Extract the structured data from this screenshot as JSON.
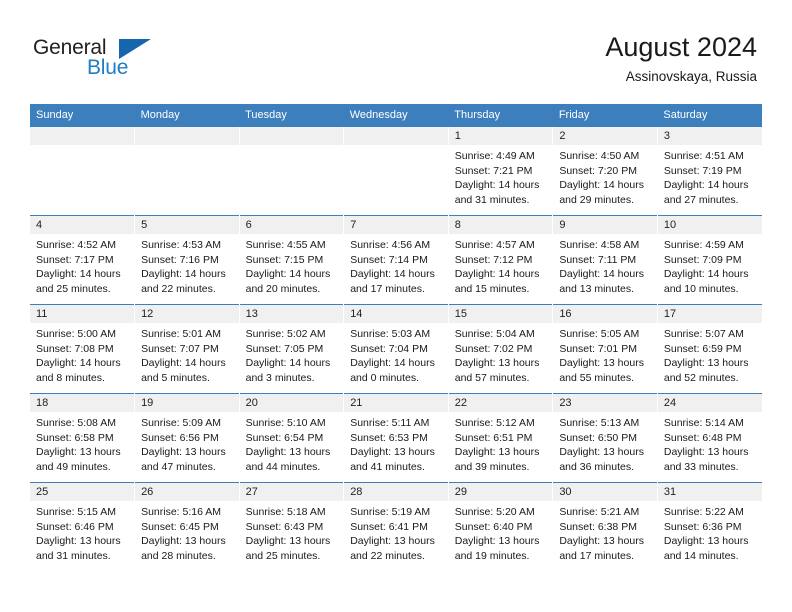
{
  "brand": {
    "name_top": "General",
    "name_bottom": "Blue",
    "triangle_color": "#1566ad",
    "blue_color": "#1f7fc4",
    "dark_color": "#231f20"
  },
  "header": {
    "title": "August 2024",
    "subtitle": "Assinovskaya, Russia"
  },
  "theme": {
    "header_bg": "#3d7ebd",
    "header_text": "#ffffff",
    "daynum_bg": "#f0f0f0",
    "cell_bg": "#ffffff",
    "row_border": "#3d7ebd"
  },
  "weekdays": [
    "Sunday",
    "Monday",
    "Tuesday",
    "Wednesday",
    "Thursday",
    "Friday",
    "Saturday"
  ],
  "labels": {
    "sunrise_prefix": "Sunrise: ",
    "sunset_prefix": "Sunset: ",
    "daylight_prefix": "Daylight: "
  },
  "weeks": [
    [
      {
        "day": "",
        "empty": true
      },
      {
        "day": "",
        "empty": true
      },
      {
        "day": "",
        "empty": true
      },
      {
        "day": "",
        "empty": true
      },
      {
        "day": "1",
        "sunrise": "Sunrise: 4:49 AM",
        "sunset": "Sunset: 7:21 PM",
        "daylight": "Daylight: 14 hours and 31 minutes."
      },
      {
        "day": "2",
        "sunrise": "Sunrise: 4:50 AM",
        "sunset": "Sunset: 7:20 PM",
        "daylight": "Daylight: 14 hours and 29 minutes."
      },
      {
        "day": "3",
        "sunrise": "Sunrise: 4:51 AM",
        "sunset": "Sunset: 7:19 PM",
        "daylight": "Daylight: 14 hours and 27 minutes."
      }
    ],
    [
      {
        "day": "4",
        "sunrise": "Sunrise: 4:52 AM",
        "sunset": "Sunset: 7:17 PM",
        "daylight": "Daylight: 14 hours and 25 minutes."
      },
      {
        "day": "5",
        "sunrise": "Sunrise: 4:53 AM",
        "sunset": "Sunset: 7:16 PM",
        "daylight": "Daylight: 14 hours and 22 minutes."
      },
      {
        "day": "6",
        "sunrise": "Sunrise: 4:55 AM",
        "sunset": "Sunset: 7:15 PM",
        "daylight": "Daylight: 14 hours and 20 minutes."
      },
      {
        "day": "7",
        "sunrise": "Sunrise: 4:56 AM",
        "sunset": "Sunset: 7:14 PM",
        "daylight": "Daylight: 14 hours and 17 minutes."
      },
      {
        "day": "8",
        "sunrise": "Sunrise: 4:57 AM",
        "sunset": "Sunset: 7:12 PM",
        "daylight": "Daylight: 14 hours and 15 minutes."
      },
      {
        "day": "9",
        "sunrise": "Sunrise: 4:58 AM",
        "sunset": "Sunset: 7:11 PM",
        "daylight": "Daylight: 14 hours and 13 minutes."
      },
      {
        "day": "10",
        "sunrise": "Sunrise: 4:59 AM",
        "sunset": "Sunset: 7:09 PM",
        "daylight": "Daylight: 14 hours and 10 minutes."
      }
    ],
    [
      {
        "day": "11",
        "sunrise": "Sunrise: 5:00 AM",
        "sunset": "Sunset: 7:08 PM",
        "daylight": "Daylight: 14 hours and 8 minutes."
      },
      {
        "day": "12",
        "sunrise": "Sunrise: 5:01 AM",
        "sunset": "Sunset: 7:07 PM",
        "daylight": "Daylight: 14 hours and 5 minutes."
      },
      {
        "day": "13",
        "sunrise": "Sunrise: 5:02 AM",
        "sunset": "Sunset: 7:05 PM",
        "daylight": "Daylight: 14 hours and 3 minutes."
      },
      {
        "day": "14",
        "sunrise": "Sunrise: 5:03 AM",
        "sunset": "Sunset: 7:04 PM",
        "daylight": "Daylight: 14 hours and 0 minutes."
      },
      {
        "day": "15",
        "sunrise": "Sunrise: 5:04 AM",
        "sunset": "Sunset: 7:02 PM",
        "daylight": "Daylight: 13 hours and 57 minutes."
      },
      {
        "day": "16",
        "sunrise": "Sunrise: 5:05 AM",
        "sunset": "Sunset: 7:01 PM",
        "daylight": "Daylight: 13 hours and 55 minutes."
      },
      {
        "day": "17",
        "sunrise": "Sunrise: 5:07 AM",
        "sunset": "Sunset: 6:59 PM",
        "daylight": "Daylight: 13 hours and 52 minutes."
      }
    ],
    [
      {
        "day": "18",
        "sunrise": "Sunrise: 5:08 AM",
        "sunset": "Sunset: 6:58 PM",
        "daylight": "Daylight: 13 hours and 49 minutes."
      },
      {
        "day": "19",
        "sunrise": "Sunrise: 5:09 AM",
        "sunset": "Sunset: 6:56 PM",
        "daylight": "Daylight: 13 hours and 47 minutes."
      },
      {
        "day": "20",
        "sunrise": "Sunrise: 5:10 AM",
        "sunset": "Sunset: 6:54 PM",
        "daylight": "Daylight: 13 hours and 44 minutes."
      },
      {
        "day": "21",
        "sunrise": "Sunrise: 5:11 AM",
        "sunset": "Sunset: 6:53 PM",
        "daylight": "Daylight: 13 hours and 41 minutes."
      },
      {
        "day": "22",
        "sunrise": "Sunrise: 5:12 AM",
        "sunset": "Sunset: 6:51 PM",
        "daylight": "Daylight: 13 hours and 39 minutes."
      },
      {
        "day": "23",
        "sunrise": "Sunrise: 5:13 AM",
        "sunset": "Sunset: 6:50 PM",
        "daylight": "Daylight: 13 hours and 36 minutes."
      },
      {
        "day": "24",
        "sunrise": "Sunrise: 5:14 AM",
        "sunset": "Sunset: 6:48 PM",
        "daylight": "Daylight: 13 hours and 33 minutes."
      }
    ],
    [
      {
        "day": "25",
        "sunrise": "Sunrise: 5:15 AM",
        "sunset": "Sunset: 6:46 PM",
        "daylight": "Daylight: 13 hours and 31 minutes."
      },
      {
        "day": "26",
        "sunrise": "Sunrise: 5:16 AM",
        "sunset": "Sunset: 6:45 PM",
        "daylight": "Daylight: 13 hours and 28 minutes."
      },
      {
        "day": "27",
        "sunrise": "Sunrise: 5:18 AM",
        "sunset": "Sunset: 6:43 PM",
        "daylight": "Daylight: 13 hours and 25 minutes."
      },
      {
        "day": "28",
        "sunrise": "Sunrise: 5:19 AM",
        "sunset": "Sunset: 6:41 PM",
        "daylight": "Daylight: 13 hours and 22 minutes."
      },
      {
        "day": "29",
        "sunrise": "Sunrise: 5:20 AM",
        "sunset": "Sunset: 6:40 PM",
        "daylight": "Daylight: 13 hours and 19 minutes."
      },
      {
        "day": "30",
        "sunrise": "Sunrise: 5:21 AM",
        "sunset": "Sunset: 6:38 PM",
        "daylight": "Daylight: 13 hours and 17 minutes."
      },
      {
        "day": "31",
        "sunrise": "Sunrise: 5:22 AM",
        "sunset": "Sunset: 6:36 PM",
        "daylight": "Daylight: 13 hours and 14 minutes."
      }
    ]
  ]
}
